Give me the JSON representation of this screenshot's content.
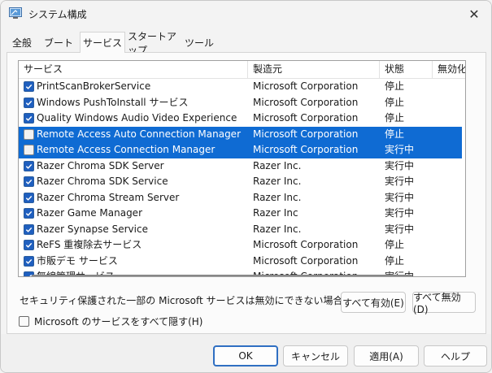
{
  "window": {
    "title": "システム構成",
    "close_glyph": "✕"
  },
  "tabs": [
    {
      "label": "全般"
    },
    {
      "label": "ブート"
    },
    {
      "label": "サービス"
    },
    {
      "label": "スタートアップ"
    },
    {
      "label": "ツール"
    }
  ],
  "active_tab": "サービス",
  "table": {
    "columns": [
      "サービス",
      "製造元",
      "状態",
      "無効化"
    ],
    "rows": [
      {
        "checked": true,
        "service": "PrintScanBrokerService",
        "manufacturer": "Microsoft Corporation",
        "status": "停止",
        "selected": false
      },
      {
        "checked": true,
        "service": "Windows PushToInstall サービス",
        "manufacturer": "Microsoft Corporation",
        "status": "停止",
        "selected": false
      },
      {
        "checked": true,
        "service": "Quality Windows Audio Video Experience",
        "manufacturer": "Microsoft Corporation",
        "status": "停止",
        "selected": false
      },
      {
        "checked": false,
        "service": "Remote Access Auto Connection Manager",
        "manufacturer": "Microsoft Corporation",
        "status": "停止",
        "selected": true
      },
      {
        "checked": false,
        "service": "Remote Access Connection Manager",
        "manufacturer": "Microsoft Corporation",
        "status": "実行中",
        "selected": true
      },
      {
        "checked": true,
        "service": "Razer Chroma SDK Server",
        "manufacturer": "Razer Inc.",
        "status": "実行中",
        "selected": false
      },
      {
        "checked": true,
        "service": "Razer Chroma SDK Service",
        "manufacturer": "Razer Inc.",
        "status": "実行中",
        "selected": false
      },
      {
        "checked": true,
        "service": "Razer Chroma Stream Server",
        "manufacturer": "Razer Inc.",
        "status": "実行中",
        "selected": false
      },
      {
        "checked": true,
        "service": "Razer Game Manager",
        "manufacturer": "Razer Inc",
        "status": "実行中",
        "selected": false
      },
      {
        "checked": true,
        "service": "Razer Synapse Service",
        "manufacturer": "Razer Inc.",
        "status": "実行中",
        "selected": false
      },
      {
        "checked": true,
        "service": "ReFS 重複除去サービス",
        "manufacturer": "Microsoft Corporation",
        "status": "停止",
        "selected": false
      },
      {
        "checked": true,
        "service": "市販デモ サービス",
        "manufacturer": "Microsoft Corporation",
        "status": "停止",
        "selected": false
      },
      {
        "checked": true,
        "service": "無線管理サービス",
        "manufacturer": "Microsoft Corporation",
        "status": "実行中",
        "selected": false
      }
    ]
  },
  "note": "セキュリティ保護された一部の Microsoft サービスは無効にできない場合があります。",
  "buttons": {
    "enable_all": "すべて有効(E)",
    "disable_all": "すべて無効(D)",
    "hide_ms": "Microsoft のサービスをすべて隠す(H)",
    "ok": "OK",
    "cancel": "キャンセル",
    "apply": "適用(A)",
    "help": "ヘルプ"
  },
  "colors": {
    "selection": "#0f6bd3",
    "checkbox": "#1f5fbf"
  }
}
